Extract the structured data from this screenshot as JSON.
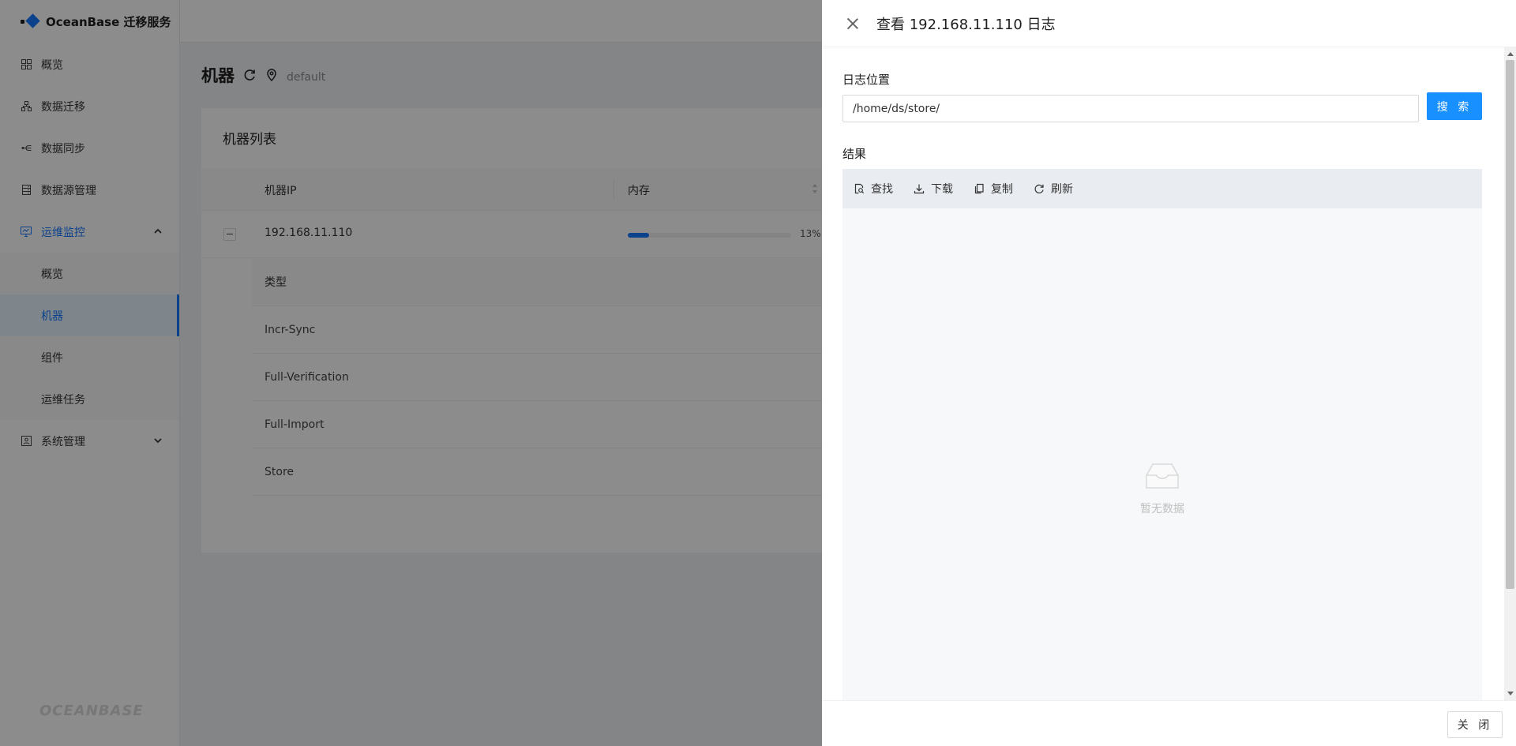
{
  "brand": {
    "name": "OceanBase 迁移服务",
    "watermark": "OCEANBASE"
  },
  "sidebar": {
    "items": [
      {
        "label": "概览",
        "icon": "grid-icon"
      },
      {
        "label": "数据迁移",
        "icon": "migration-icon"
      },
      {
        "label": "数据同步",
        "icon": "sync-icon"
      },
      {
        "label": "数据源管理",
        "icon": "database-icon"
      },
      {
        "label": "运维监控",
        "icon": "monitor-icon",
        "expanded": true,
        "active": true
      },
      {
        "label": "系统管理",
        "icon": "settings-icon",
        "expanded": false
      }
    ],
    "submenu": [
      {
        "label": "概览"
      },
      {
        "label": "机器",
        "selected": true
      },
      {
        "label": "组件"
      },
      {
        "label": "运维任务"
      }
    ]
  },
  "page": {
    "title": "机器",
    "region": "default"
  },
  "machine_list": {
    "title": "机器列表",
    "columns": [
      "机器IP",
      "内存"
    ],
    "rows": [
      {
        "ip": "192.168.11.110",
        "memory_percent": 13,
        "memory_text": "13%"
      }
    ],
    "sub_table": {
      "header": "类型",
      "rows": [
        "Incr-Sync",
        "Full-Verification",
        "Full-Import",
        "Store"
      ]
    }
  },
  "drawer": {
    "title": "查看 192.168.11.110 日志",
    "log_location_label": "日志位置",
    "log_path": "/home/ds/store/",
    "search_label": "搜 索",
    "result_label": "结果",
    "tools": [
      {
        "label": "查找",
        "icon": "find-icon"
      },
      {
        "label": "下载",
        "icon": "download-icon"
      },
      {
        "label": "复制",
        "icon": "copy-icon"
      },
      {
        "label": "刷新",
        "icon": "refresh-icon"
      }
    ],
    "empty_text": "暂无数据",
    "close_label": "关 闭"
  },
  "colors": {
    "primary": "#1890ff",
    "mask": "rgba(0,0,0,0.45)"
  }
}
